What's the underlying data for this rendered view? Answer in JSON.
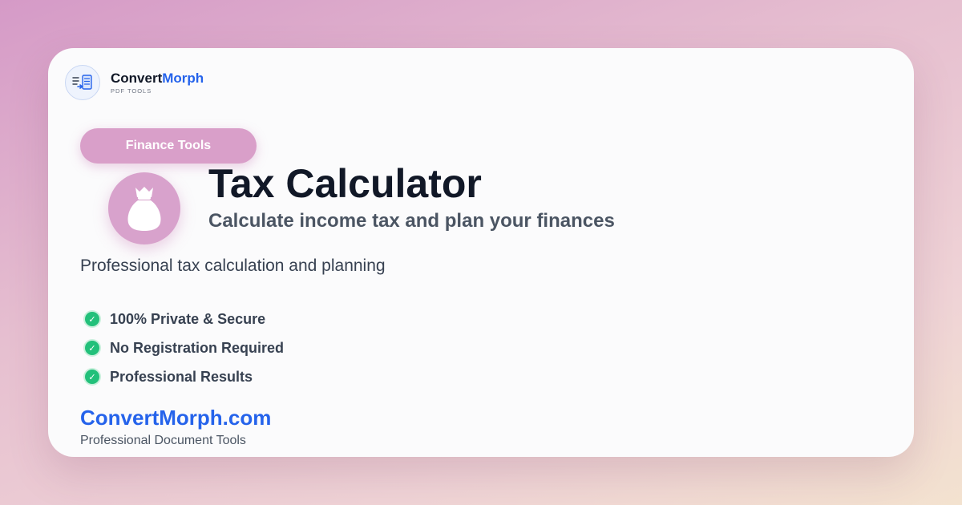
{
  "brand": {
    "name_primary": "Convert",
    "name_accent": "Morph",
    "subtitle": "PDF TOOLS",
    "icon": "document-convert-icon",
    "accent_color": "#2563eb"
  },
  "category": {
    "label": "Finance Tools",
    "color": "#d99fc9"
  },
  "tool": {
    "icon": "money-bag-icon",
    "title": "Tax Calculator",
    "subtitle": "Calculate income tax and plan your finances",
    "description": "Professional tax calculation and planning"
  },
  "features": [
    {
      "label": "100% Private & Secure",
      "icon": "check-circle-icon"
    },
    {
      "label": "No Registration Required",
      "icon": "check-circle-icon"
    },
    {
      "label": "Professional Results",
      "icon": "check-circle-icon"
    }
  ],
  "footer": {
    "site": "ConvertMorph.com",
    "tagline": "Professional Document Tools"
  },
  "colors": {
    "check": "#22c07a",
    "title": "#111827"
  }
}
